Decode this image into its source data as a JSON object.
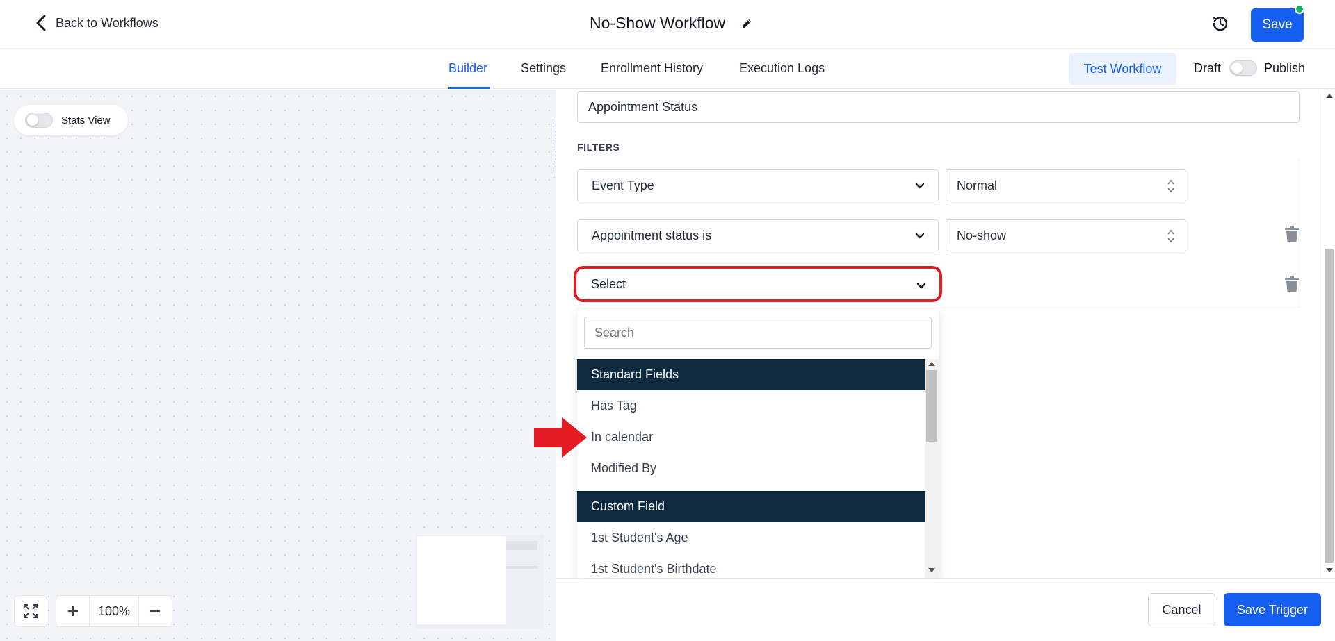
{
  "header": {
    "back_label": "Back to Workflows",
    "title": "No-Show Workflow",
    "save_label": "Save"
  },
  "tabs": [
    {
      "label": "Builder",
      "active": true
    },
    {
      "label": "Settings",
      "active": false
    },
    {
      "label": "Enrollment History",
      "active": false
    },
    {
      "label": "Execution Logs",
      "active": false
    }
  ],
  "topright": {
    "test_label": "Test Workflow",
    "draft_label": "Draft",
    "publish_label": "Publish",
    "published": false
  },
  "canvas": {
    "stats_label": "Stats View",
    "stats_on": false,
    "zoom_value": "100%"
  },
  "panel": {
    "trigger_name": "Appointment Status",
    "filters_label": "FILTERS",
    "filters": [
      {
        "field": "Event Type",
        "value": "Normal"
      },
      {
        "field": "Appointment status is",
        "value": "No-show"
      },
      {
        "field": "Select",
        "value": ""
      }
    ]
  },
  "dropdown": {
    "search_placeholder": "Search",
    "groups": [
      {
        "label": "Standard Fields",
        "items": [
          "Has Tag",
          "In calendar",
          "Modified By"
        ]
      },
      {
        "label": "Custom Field",
        "items": [
          "1st Student's Age",
          "1st Student's Birthdate"
        ]
      }
    ]
  },
  "footer": {
    "cancel_label": "Cancel",
    "save_trigger_label": "Save Trigger"
  },
  "colors": {
    "primary": "#155eef",
    "group_header": "#0c2a40",
    "highlight": "#e31b23",
    "status_dot": "#16b364"
  },
  "icons": [
    "chevron-left-icon",
    "pencil-icon",
    "history-icon",
    "expand-icon",
    "plus-icon",
    "minus-icon",
    "chevron-down-icon",
    "sort-updown-icon",
    "trash-icon",
    "red-arrow-icon"
  ]
}
